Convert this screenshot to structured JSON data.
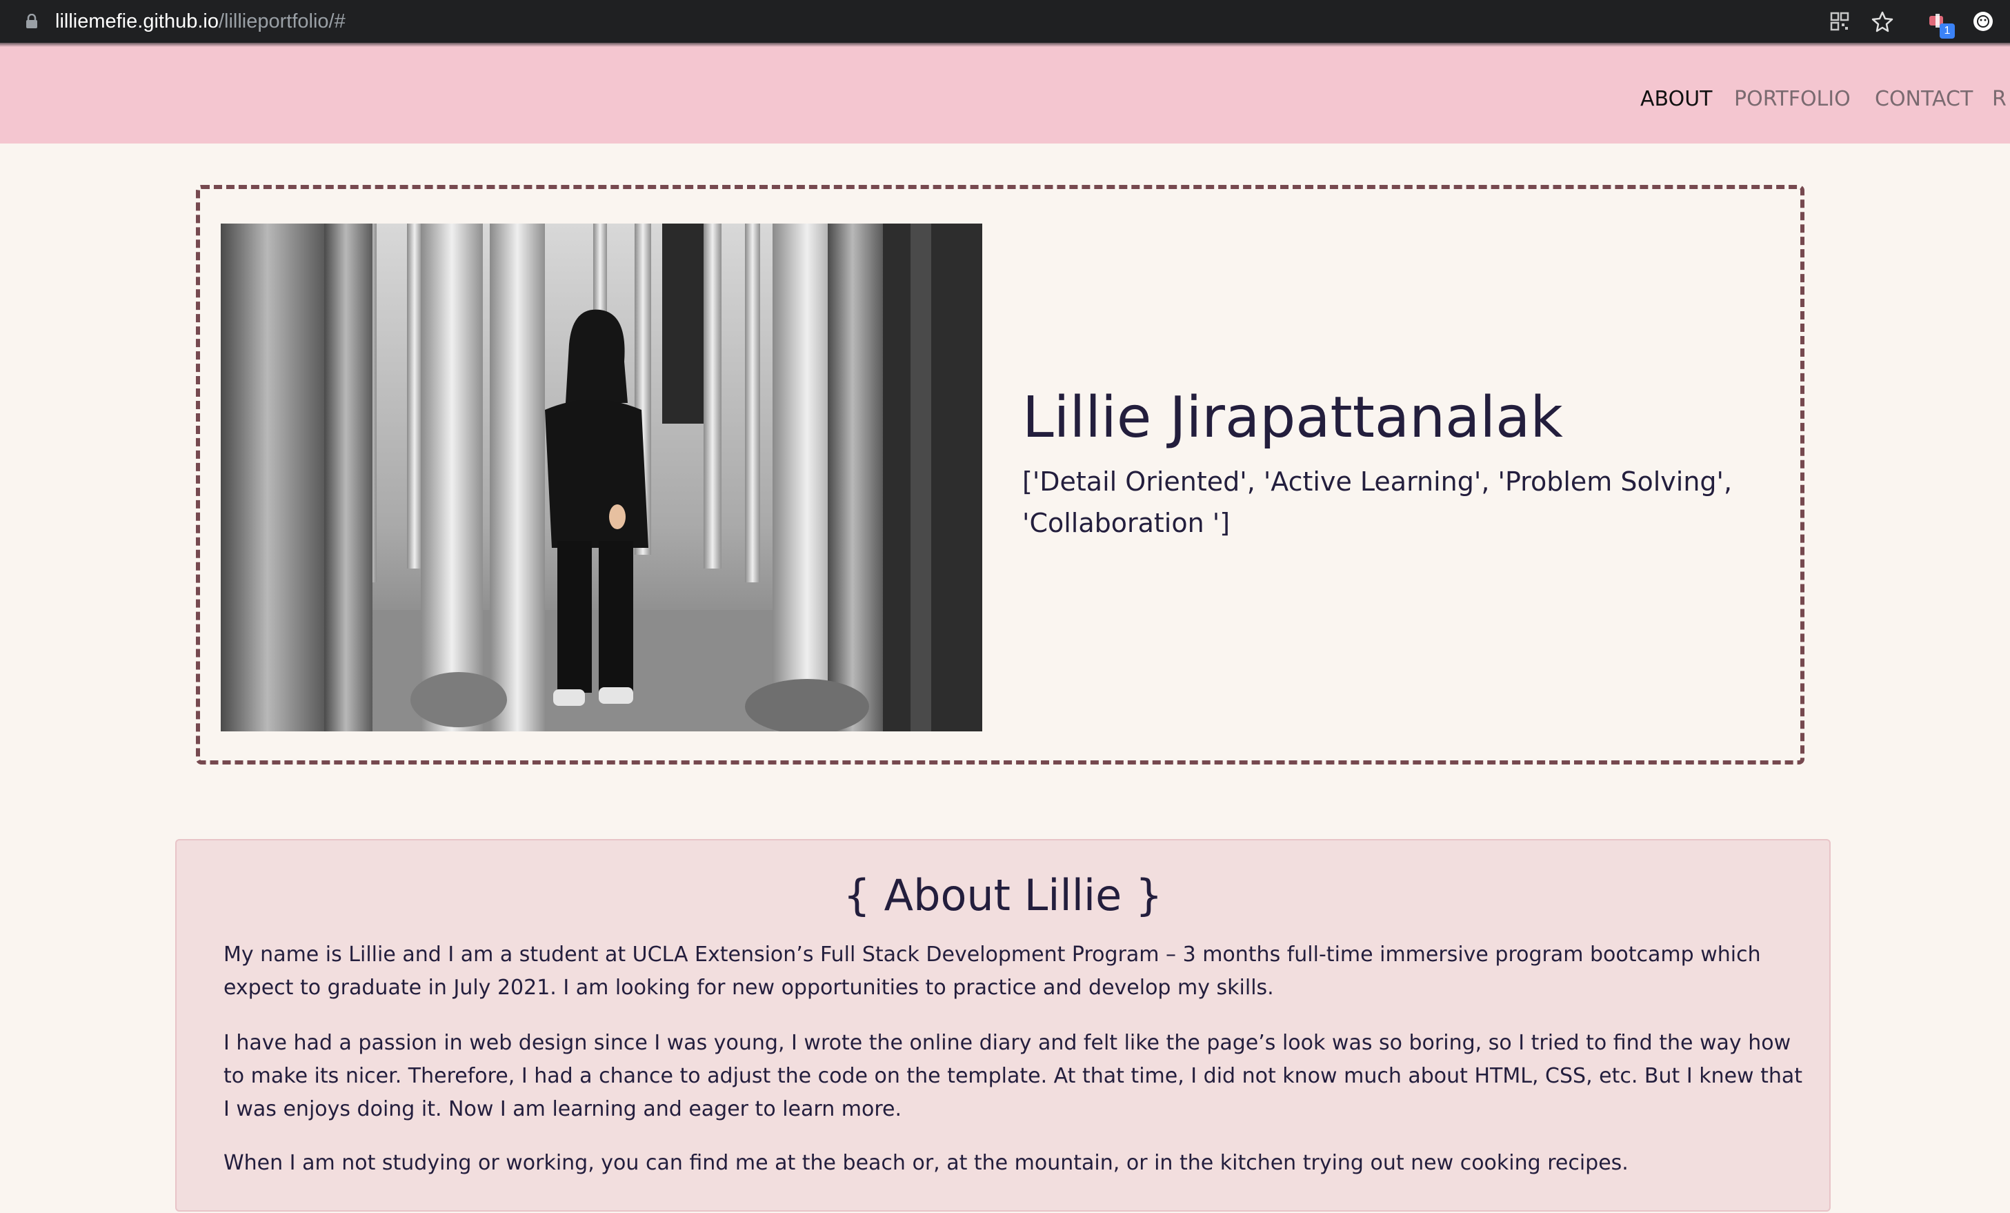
{
  "browser": {
    "url_host": "lilliemefie.github.io",
    "url_path": "/lillieportfolio/#",
    "extension_badge": "1",
    "icons": [
      "lock-icon",
      "qr-code-icon",
      "bookmark-star-icon",
      "extension-icon",
      "profile-icon"
    ]
  },
  "nav": {
    "about": "ABOUT",
    "portfolio": "PORTFOLIO",
    "contact": "CONTACT",
    "truncated": "R"
  },
  "hero": {
    "name": "Lillie Jirapattanalak",
    "skills": "['Detail Oriented', 'Active Learning', 'Problem Solving', 'Collaboration ']"
  },
  "about": {
    "title": "{ About Lillie }",
    "paragraphs": [
      "My name is Lillie and I am a student at UCLA Extension’s Full Stack Development Program – 3 months full-time immersive program bootcamp which expect to graduate in July 2021. I am looking for new opportunities to practice and develop my skills.",
      "I have had a passion in web design since I was young, I wrote the online diary and felt like the page’s look was so boring, so I tried to find the way how to make its nicer. Therefore, I had a chance to adjust the code on the template. At that time, I did not know much about HTML, CSS, etc. But I knew that I was enjoys doing it. Now I am learning and eager to learn more.",
      "When I am not studying or working, you can find me at the beach or, at the mountain, or in the kitchen trying out new cooking recipes."
    ]
  },
  "colors": {
    "navbar": "#f4c6d0",
    "page_background": "#faf5f0",
    "hero_border": "#76494f",
    "about_background": "#f2dede",
    "text": "#231e3d"
  }
}
